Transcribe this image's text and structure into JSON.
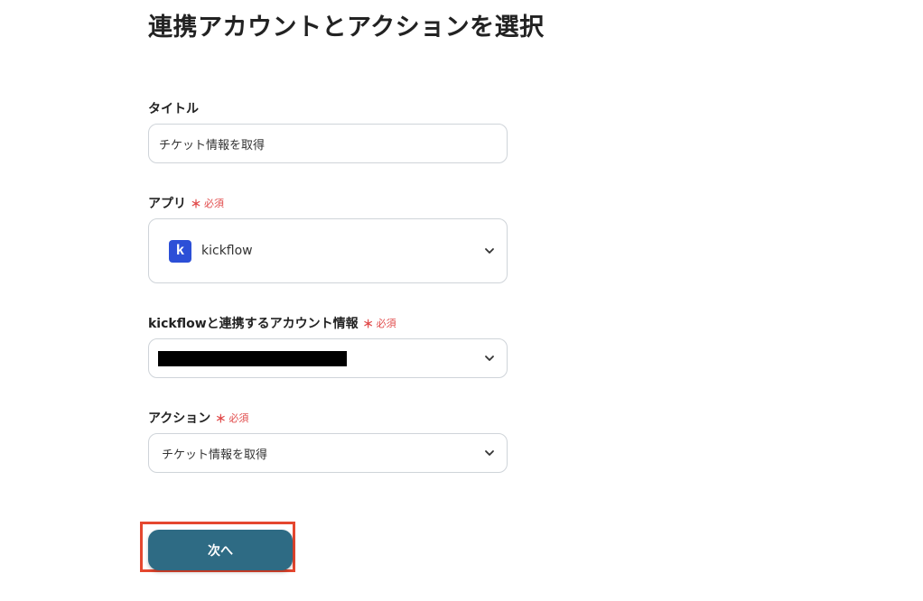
{
  "page": {
    "title": "連携アカウントとアクションを選択"
  },
  "form": {
    "title_field": {
      "label": "タイトル",
      "value": "チケット情報を取得"
    },
    "app_field": {
      "label": "アプリ",
      "required_mark": "＊",
      "required_text": "必須",
      "selected_app": "kickflow",
      "app_logo_letter": "k",
      "app_logo_color": "#2c4fd7"
    },
    "account_field": {
      "label": "kickflowと連携するアカウント情報",
      "required_mark": "＊",
      "required_text": "必須"
    },
    "action_field": {
      "label": "アクション",
      "required_mark": "＊",
      "required_text": "必須",
      "selected_action": "チケット情報を取得"
    }
  },
  "actions": {
    "next_label": "次へ",
    "next_color": "#2e6b84",
    "highlight_color": "#e5472f"
  }
}
